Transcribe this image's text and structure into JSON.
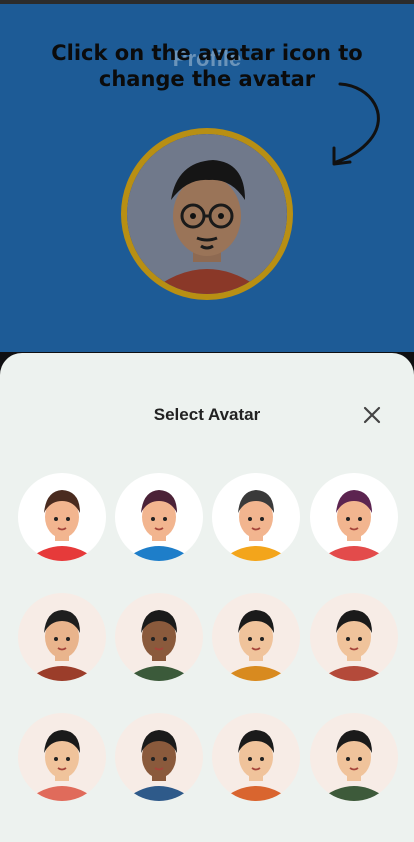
{
  "profile": {
    "title": "Profile",
    "tooltip": "Click on the avatar icon to\nchange the avatar"
  },
  "sheet": {
    "title": "Select Avatar",
    "close_icon": "close-icon"
  },
  "colors": {
    "top_bg": "#1d5b96",
    "sheet_bg": "#edf2ef",
    "avatar_ring": "#b88f13"
  },
  "avatars": [
    {
      "name": "avatar-bearded-man-red-shirt",
      "skin": "#f2b58f",
      "hair": "#4a2b1f",
      "shirt": "#e63a3a",
      "white": true
    },
    {
      "name": "avatar-curly-hair-woman-blue-shirt",
      "skin": "#f2b58f",
      "hair": "#4b2237",
      "shirt": "#1e7ec9",
      "white": true
    },
    {
      "name": "avatar-boy-orange-hoodie",
      "skin": "#f2b58f",
      "hair": "#3a3a3a",
      "shirt": "#f3a51b",
      "white": true
    },
    {
      "name": "avatar-woman-red-jacket",
      "skin": "#f2b58f",
      "hair": "#5c2450",
      "shirt": "#e34b4b",
      "white": true
    },
    {
      "name": "avatar-man-glasses-brown-shirt",
      "skin": "#e9b48c",
      "hair": "#1e1e1e",
      "shirt": "#9b3d2a",
      "white": false
    },
    {
      "name": "avatar-woman-dark-skin-green-shirt",
      "skin": "#8a5a3c",
      "hair": "#1a1a1a",
      "shirt": "#3b5a3a",
      "white": false
    },
    {
      "name": "avatar-woman-bangs-orange-shirt",
      "skin": "#f0c39b",
      "hair": "#1a1a1a",
      "shirt": "#d88a1f",
      "white": false
    },
    {
      "name": "avatar-man-spiky-hair-red-shirt",
      "skin": "#f0c39b",
      "hair": "#1a1a1a",
      "shirt": "#b44a3a",
      "white": false
    },
    {
      "name": "avatar-man-glasses-coral-shirt",
      "skin": "#f0c39b",
      "hair": "#1a1a1a",
      "shirt": "#e06b5b",
      "white": false
    },
    {
      "name": "avatar-bearded-man-blue-shirt",
      "skin": "#8a5a3c",
      "hair": "#1a1a1a",
      "shirt": "#2e5a8a",
      "white": false
    },
    {
      "name": "avatar-bearded-man-orange-shirt",
      "skin": "#f0c39b",
      "hair": "#1a1a1a",
      "shirt": "#d9652f",
      "white": false
    },
    {
      "name": "avatar-man-side-hair-green-shirt",
      "skin": "#f0c39b",
      "hair": "#1a1a1a",
      "shirt": "#3d5a3a",
      "white": false
    }
  ]
}
